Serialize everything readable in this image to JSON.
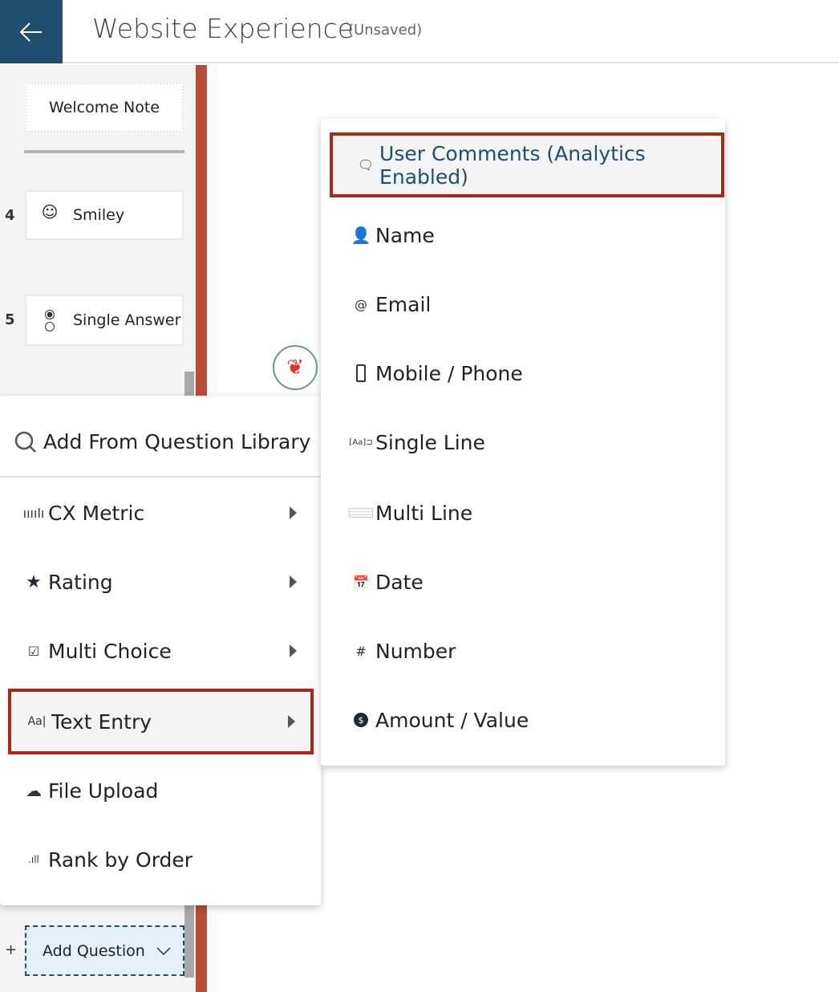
{
  "header": {
    "title": "Website Experience",
    "status": "(Unsaved)",
    "back_icon": "arrow-left-icon"
  },
  "colors": {
    "brand": "#1f4e6e",
    "highlight_border": "#a8291b",
    "divider_bar": "#b84c38"
  },
  "survey": {
    "welcome": "Welcome Note",
    "questions": [
      {
        "number": "4",
        "label": "Smiley",
        "icon": "smiley-icon"
      },
      {
        "number": "5",
        "label": "Single Answer",
        "icon": "radio-icon"
      }
    ],
    "add_question": {
      "plus": "+",
      "label": "Add Question"
    }
  },
  "question_menu": {
    "search": "Add From Question Library",
    "items": [
      {
        "label": "CX Metric",
        "icon": "metric-icon",
        "submenu": true
      },
      {
        "label": "Rating",
        "icon": "star-icon",
        "submenu": true
      },
      {
        "label": "Multi Choice",
        "icon": "checkbox-icon",
        "submenu": true
      },
      {
        "label": "Text Entry",
        "icon": "text-entry-icon",
        "submenu": true,
        "selected": true
      },
      {
        "label": "File Upload",
        "icon": "cloud-upload-icon",
        "submenu": false
      },
      {
        "label": "Rank by Order",
        "icon": "rank-icon",
        "submenu": false
      }
    ]
  },
  "text_entry_menu": {
    "items": [
      {
        "label": "User Comments (Analytics Enabled)",
        "icon": "comment-icon",
        "selected": true
      },
      {
        "label": "Name",
        "icon": "user-icon"
      },
      {
        "label": "Email",
        "icon": "at-icon"
      },
      {
        "label": "Mobile / Phone",
        "icon": "phone-icon"
      },
      {
        "label": "Single Line",
        "icon": "single-line-icon"
      },
      {
        "label": "Multi Line",
        "icon": "multi-line-icon"
      },
      {
        "label": "Date",
        "icon": "calendar-icon"
      },
      {
        "label": "Number",
        "icon": "hash-icon"
      },
      {
        "label": "Amount / Value",
        "icon": "dollar-icon"
      }
    ]
  }
}
